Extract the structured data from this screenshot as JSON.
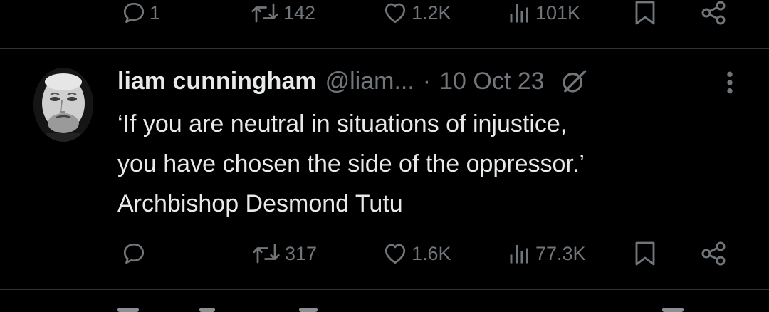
{
  "prev_tweet": {
    "reply_count": "1",
    "retweet_count": "142",
    "like_count": "1.2K",
    "view_count": "101K"
  },
  "tweet": {
    "author_name": "liam cunningham",
    "author_handle": "@liam...",
    "separator": "·",
    "date": "10 Oct 23",
    "text_lines": [
      "‘If you are neutral in situations of injustice,",
      "you have chosen the side of the oppressor.’",
      "Archbishop Desmond Tutu"
    ],
    "retweet_count": "317",
    "like_count": "1.6K",
    "view_count": "77.3K"
  },
  "colors": {
    "background": "#000000",
    "text_primary": "#e7e9ea",
    "text_secondary": "#71767b",
    "divider": "#2f3336"
  },
  "icons": [
    "reply-icon",
    "retweet-icon",
    "like-icon",
    "views-icon",
    "bookmark-icon",
    "share-icon",
    "grok-icon",
    "more-icon"
  ]
}
